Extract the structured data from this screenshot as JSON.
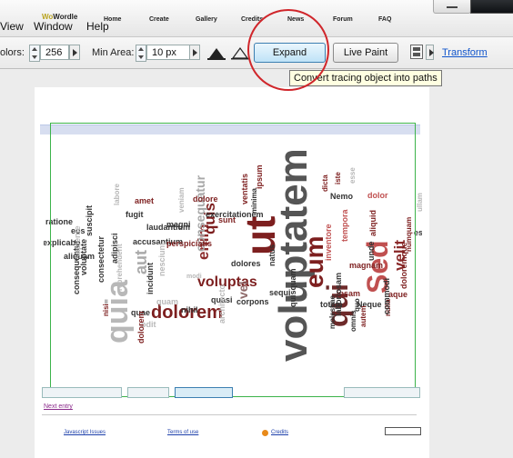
{
  "menu": {
    "items": [
      "View",
      "Window",
      "Help"
    ]
  },
  "controls": {
    "colors_label": "olors:",
    "colors_value": "256",
    "min_area_label": "Min Area:",
    "min_area_value": "10 px",
    "expand_label": "Expand",
    "live_paint_label": "Live Paint",
    "transform_label": "Transform"
  },
  "tooltip": "Convert tracing object into paths",
  "page": {
    "logo_a": "Wo",
    "logo_b": "Wordle",
    "nav": [
      "Home",
      "Create",
      "Gallery",
      "Credits",
      "News",
      "Forum",
      "FAQ"
    ],
    "subnav": "Next entry",
    "footer_links": [
      "Javascript Issues",
      "Terms of use",
      "Credits"
    ]
  },
  "cloud_words": [
    {
      "t": "voluptatem",
      "h": "v",
      "c": "#555555"
    },
    {
      "t": "quia",
      "h": "v",
      "c": "#b8b8b8"
    },
    {
      "t": "ut",
      "h": "v",
      "c": "#7d1f1f"
    },
    {
      "t": "Sed",
      "h": "v",
      "c": "#c05050"
    },
    {
      "t": "qui",
      "h": "v",
      "c": "#6e2a2a"
    },
    {
      "t": "eum",
      "h": "v",
      "c": "#7d1f1f"
    },
    {
      "t": "dolorem",
      "h": "h",
      "c": "#7d1f1f"
    },
    {
      "t": "voluptas",
      "h": "h",
      "c": "#7d1f1f"
    },
    {
      "t": "enim",
      "h": "v",
      "c": "#8b2b2b"
    },
    {
      "t": "quis",
      "h": "v",
      "c": "#7d1f1f"
    },
    {
      "t": "velit",
      "h": "v",
      "c": "#8b2b2b"
    },
    {
      "t": "consequatur",
      "h": "v",
      "c": "#a8a8a8"
    },
    {
      "t": "aut",
      "h": "v",
      "c": "#aaaaaa"
    },
    {
      "t": "vel",
      "h": "v",
      "c": "#8f6a6a"
    },
    {
      "t": "laudantium",
      "h": "h",
      "c": "#333333"
    },
    {
      "t": "accusantium",
      "h": "h",
      "c": "#333333"
    },
    {
      "t": "exercitationem",
      "h": "h",
      "c": "#333333"
    },
    {
      "t": "aliquam",
      "h": "h",
      "c": "#333333"
    },
    {
      "t": "explicabo",
      "h": "h",
      "c": "#333333"
    },
    {
      "t": "ratione",
      "h": "h",
      "c": "#333333"
    },
    {
      "t": "amet",
      "h": "h",
      "c": "#7d1f1f"
    },
    {
      "t": "dolore",
      "h": "h",
      "c": "#7d1f1f"
    },
    {
      "t": "corpons",
      "h": "h",
      "c": "#333333"
    },
    {
      "t": "dolores",
      "h": "h",
      "c": "#333333"
    },
    {
      "t": "ipsam",
      "h": "h",
      "c": "#7d1f1f"
    },
    {
      "t": "Nemo",
      "h": "h",
      "c": "#333333"
    },
    {
      "t": "dolor",
      "h": "h",
      "c": "#c05050"
    },
    {
      "t": "aque",
      "h": "h",
      "c": "#7d1f1f"
    },
    {
      "t": "totam",
      "h": "h",
      "c": "#333333"
    },
    {
      "t": "Neque",
      "h": "h",
      "c": "#333333"
    },
    {
      "t": "quae",
      "h": "h",
      "c": "#333333"
    },
    {
      "t": "odit",
      "h": "h",
      "c": "#b8b8b8"
    },
    {
      "t": "quam",
      "h": "h",
      "c": "#b8b8b8"
    },
    {
      "t": "fugit",
      "h": "h",
      "c": "#333333"
    },
    {
      "t": "sunt",
      "h": "h",
      "c": "#7d1f1f"
    },
    {
      "t": "nihil",
      "h": "h",
      "c": "#333333"
    },
    {
      "t": "quasi",
      "h": "h",
      "c": "#333333"
    },
    {
      "t": "magni",
      "h": "h",
      "c": "#333333"
    },
    {
      "t": "perspiciatis",
      "h": "h",
      "c": "#7d1f1f"
    },
    {
      "t": "eos",
      "h": "h",
      "c": "#333333"
    },
    {
      "t": "est",
      "h": "h",
      "c": "#333333"
    },
    {
      "t": "magnam",
      "h": "h",
      "c": "#7d1f1f"
    },
    {
      "t": "modi",
      "h": "h",
      "c": "#b8b8b8"
    },
    {
      "t": "sequi",
      "h": "h",
      "c": "#333333"
    },
    {
      "t": "tempora",
      "h": "v",
      "c": "#c05050"
    },
    {
      "t": "inventore",
      "h": "v",
      "c": "#c05050"
    },
    {
      "t": "minima",
      "h": "v",
      "c": "#333333"
    },
    {
      "t": "dicta",
      "h": "v",
      "c": "#7d1f1f"
    },
    {
      "t": "omnis",
      "h": "v",
      "c": "#333333"
    },
    {
      "t": "quo",
      "h": "v",
      "c": "#333333"
    },
    {
      "t": "nulla",
      "h": "v",
      "c": "#7d1f1f"
    },
    {
      "t": "autem",
      "h": "v",
      "c": "#7d1f1f"
    },
    {
      "t": "unde",
      "h": "v",
      "c": "#333333"
    },
    {
      "t": "esse",
      "h": "v",
      "c": "#b8b8b8"
    },
    {
      "t": "nisi",
      "h": "v",
      "c": "#7d1f1f"
    },
    {
      "t": "ullam",
      "h": "v",
      "c": "#b8b8b8"
    },
    {
      "t": "numquam",
      "h": "v",
      "c": "#7d1f1f"
    },
    {
      "t": "labore",
      "h": "v",
      "c": "#b8b8b8"
    },
    {
      "t": "adipisci",
      "h": "v",
      "c": "#333333"
    },
    {
      "t": "voluptate",
      "h": "v",
      "c": "#333333"
    },
    {
      "t": "consequuntur",
      "h": "v",
      "c": "#333333"
    },
    {
      "t": "consectetur",
      "h": "v",
      "c": "#333333"
    },
    {
      "t": "sapiente",
      "h": "v",
      "c": "#b8b8b8"
    },
    {
      "t": "iste",
      "h": "v",
      "c": "#7d1f1f"
    },
    {
      "t": "ipsum",
      "h": "v",
      "c": "#7d1f1f"
    },
    {
      "t": "quisquam",
      "h": "v",
      "c": "#333333"
    },
    {
      "t": "incidunt",
      "h": "v",
      "c": "#333333"
    },
    {
      "t": "nesciunt",
      "h": "v",
      "c": "#b8b8b8"
    },
    {
      "t": "aliquid",
      "h": "v",
      "c": "#7d1f1f"
    },
    {
      "t": "commodi",
      "h": "v",
      "c": "#333333"
    },
    {
      "t": "doloremque",
      "h": "v",
      "c": "#7d1f1f"
    },
    {
      "t": "suscipit",
      "h": "v",
      "c": "#333333"
    },
    {
      "t": "architecto",
      "h": "v",
      "c": "#b8b8b8"
    },
    {
      "t": "molestiae",
      "h": "v",
      "c": "#333333"
    },
    {
      "t": "reprehenderit",
      "h": "v",
      "c": "#b8b8b8"
    },
    {
      "t": "veniam",
      "h": "v",
      "c": "#b8b8b8"
    },
    {
      "t": "natus",
      "h": "v",
      "c": "#333333"
    },
    {
      "t": "laboriosam",
      "h": "v",
      "c": "#333333"
    },
    {
      "t": "ventatis",
      "h": "v",
      "c": "#7d1f1f"
    },
    {
      "t": "dolorem",
      "h": "v",
      "c": "#7d1f1f"
    }
  ]
}
